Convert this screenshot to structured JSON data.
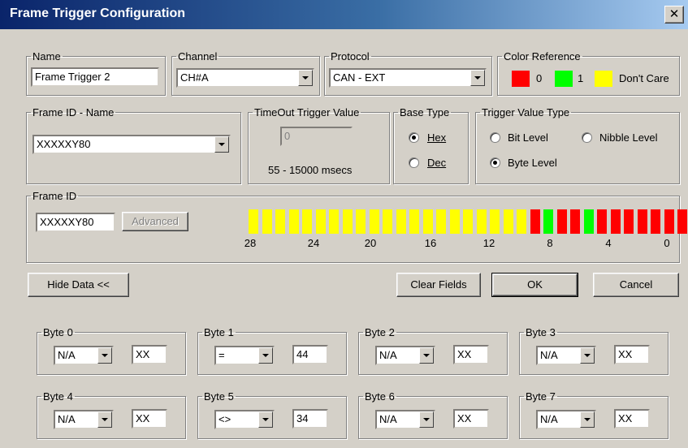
{
  "window": {
    "title": "Frame Trigger Configuration",
    "close_glyph": "✕"
  },
  "name": {
    "legend": "Name",
    "value": "Frame Trigger 2"
  },
  "channel": {
    "legend": "Channel",
    "selected": "CH#A"
  },
  "protocol": {
    "legend": "Protocol",
    "selected": "CAN - EXT"
  },
  "color_reference": {
    "legend": "Color Reference",
    "items": [
      {
        "label": "0",
        "color": "#ff0000"
      },
      {
        "label": "1",
        "color": "#00ff00"
      },
      {
        "label": "Don't Care",
        "color": "#ffff00"
      }
    ]
  },
  "frame_id_name": {
    "legend": "Frame ID - Name",
    "selected": "XXXXXY80"
  },
  "timeout": {
    "legend": "TimeOut Trigger Value",
    "value": "0",
    "range": "55 - 15000 msecs"
  },
  "base_type": {
    "legend": "Base Type",
    "options": [
      "Hex",
      "Dec"
    ],
    "selected": "Hex"
  },
  "trigger_value_type": {
    "legend": "Trigger Value Type",
    "options": [
      "Bit Level",
      "Nibble Level",
      "Byte Level"
    ],
    "selected": "Byte Level"
  },
  "frame_id": {
    "legend": "Frame  ID",
    "value": "XXXXXY80",
    "advanced_label": "Advanced",
    "bits": [
      "X",
      "X",
      "X",
      "X",
      "X",
      "X",
      "X",
      "X",
      "X",
      "X",
      "X",
      "X",
      "X",
      "X",
      "X",
      "X",
      "X",
      "X",
      "X",
      "X",
      "X",
      "0",
      "1",
      "0",
      "0",
      "1",
      "0",
      "0",
      "0",
      "0",
      "0",
      "0",
      "0"
    ],
    "tick_labels": [
      "28",
      "24",
      "20",
      "16",
      "12",
      "8",
      "4",
      "0"
    ]
  },
  "buttons": {
    "hide_data": "Hide Data <<",
    "clear_fields": "Clear Fields",
    "ok": "OK",
    "cancel": "Cancel"
  },
  "bytes": [
    {
      "legend": "Byte 0",
      "op": "N/A",
      "value": "XX"
    },
    {
      "legend": "Byte 1",
      "op": "=",
      "value": "44"
    },
    {
      "legend": "Byte 2",
      "op": "N/A",
      "value": "XX"
    },
    {
      "legend": "Byte 3",
      "op": "N/A",
      "value": "XX"
    },
    {
      "legend": "Byte 4",
      "op": "N/A",
      "value": "XX"
    },
    {
      "legend": "Byte 5",
      "op": "<>",
      "value": "34"
    },
    {
      "legend": "Byte 6",
      "op": "N/A",
      "value": "XX"
    },
    {
      "legend": "Byte 7",
      "op": "N/A",
      "value": "XX"
    }
  ]
}
